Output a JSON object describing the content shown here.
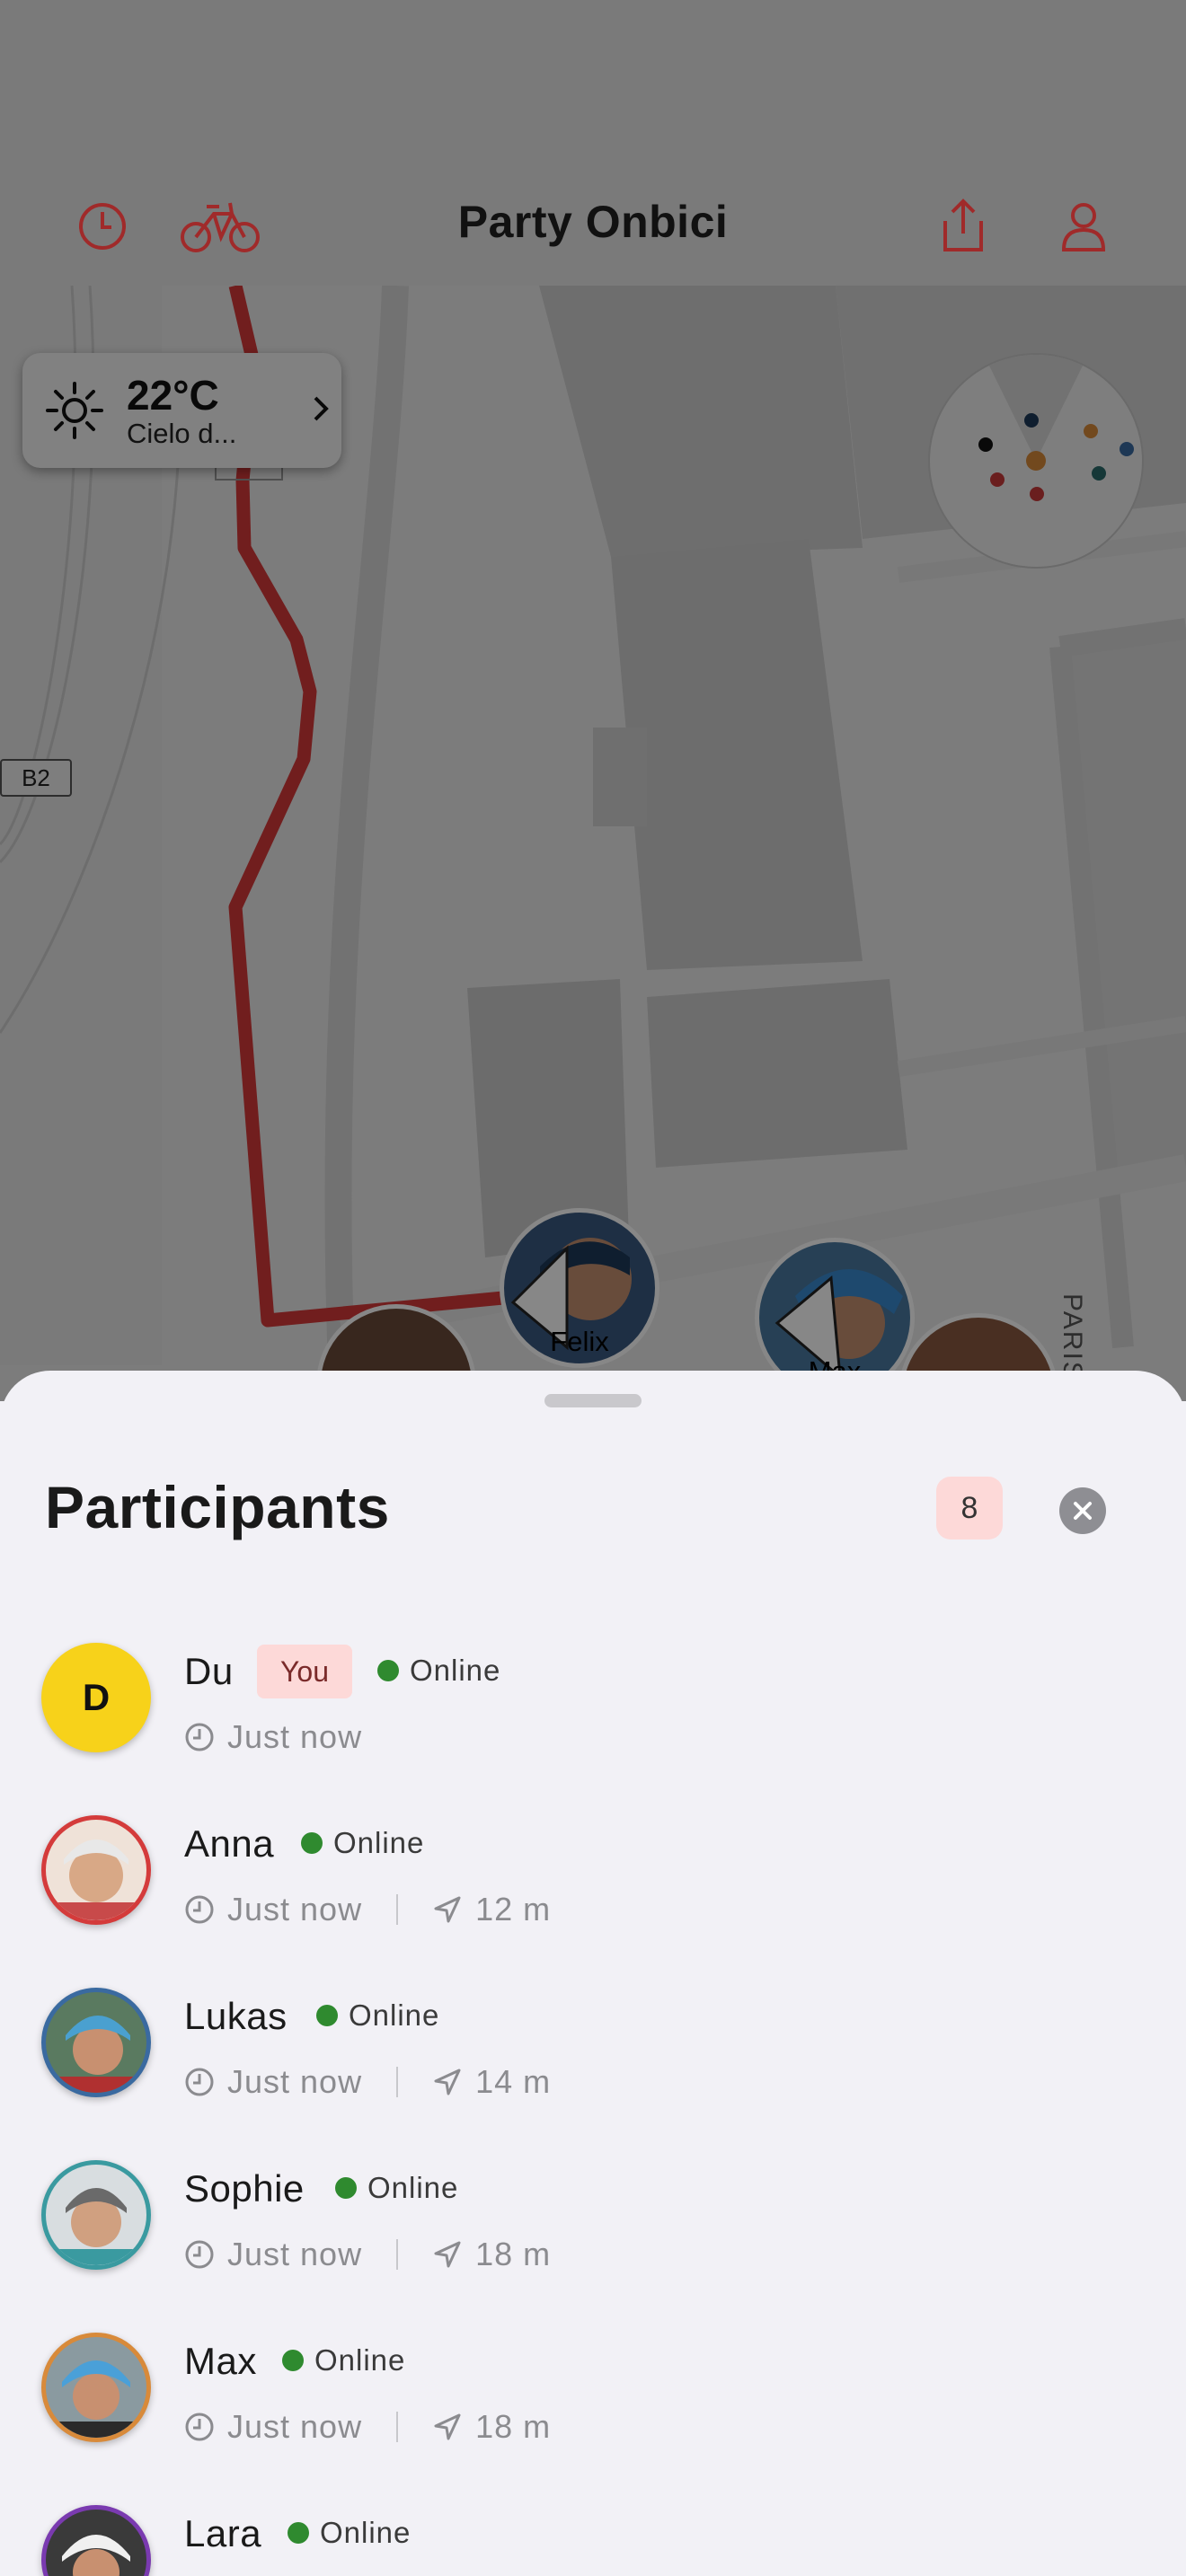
{
  "app": {
    "title": "Party Onbici",
    "accent_color": "#c83a3a",
    "icons": [
      "history-icon",
      "bike-icon",
      "share-icon",
      "profile-icon"
    ]
  },
  "weather": {
    "temperature": "22°C",
    "condition": "Cielo d..."
  },
  "map": {
    "road_label": "B2",
    "street_label": "PARISER",
    "markers": [
      {
        "name": "Felix"
      },
      {
        "name": "Max"
      }
    ]
  },
  "sheet": {
    "title": "Participants",
    "count": "8",
    "participants": [
      {
        "name": "Du",
        "initial": "D",
        "you_label": "You",
        "status": "Online",
        "last_seen": "Just now"
      },
      {
        "name": "Anna",
        "status": "Online",
        "last_seen": "Just now",
        "distance": "12 m",
        "ring": "#d43b3b"
      },
      {
        "name": "Lukas",
        "status": "Online",
        "last_seen": "Just now",
        "distance": "14 m",
        "ring": "#3a6aa0"
      },
      {
        "name": "Sophie",
        "status": "Online",
        "last_seen": "Just now",
        "distance": "18 m",
        "ring": "#3a9aa0"
      },
      {
        "name": "Max",
        "status": "Online",
        "last_seen": "Just now",
        "distance": "18 m",
        "ring": "#d88a3a"
      },
      {
        "name": "Lara",
        "status": "Online",
        "ring": "#7a3ab0"
      }
    ]
  }
}
